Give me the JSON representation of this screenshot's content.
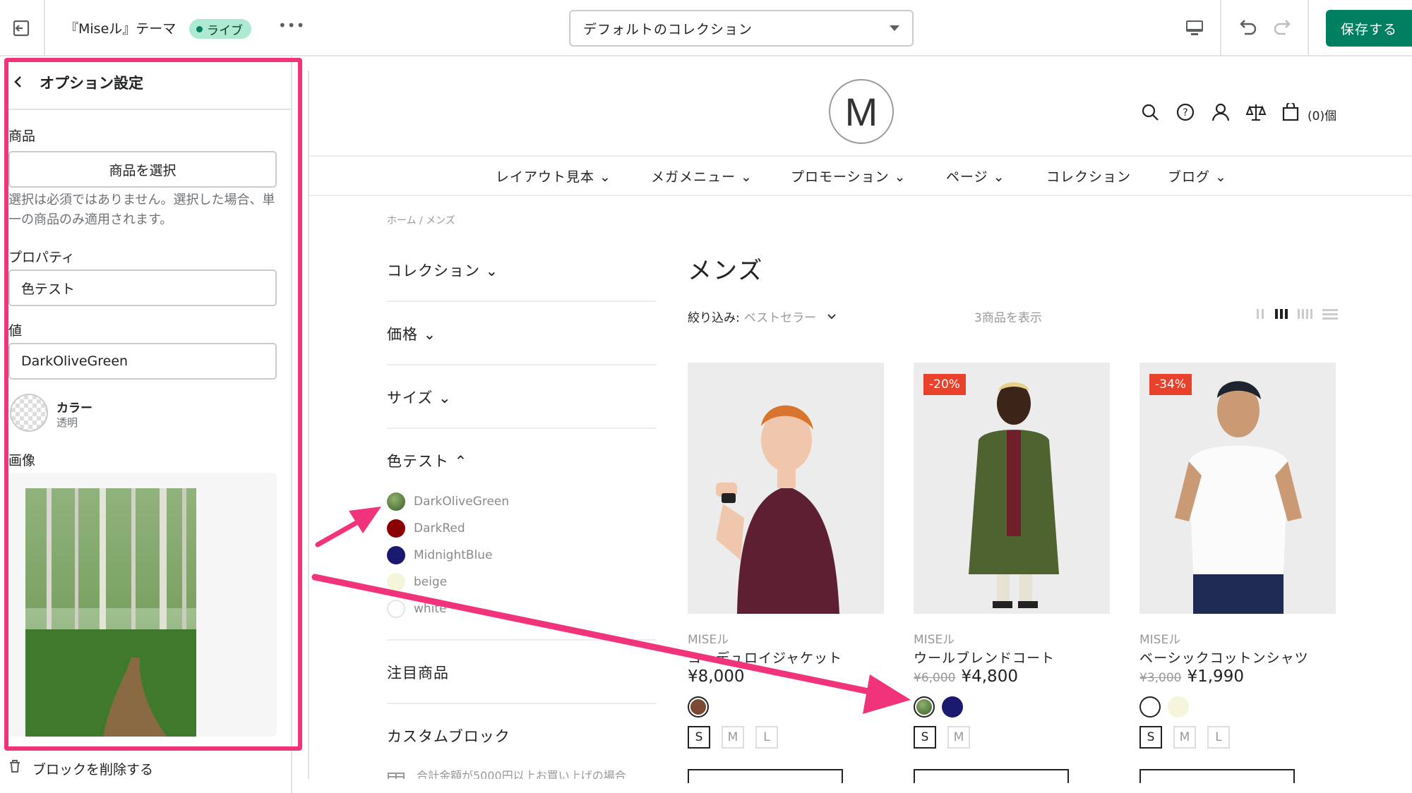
{
  "topbar": {
    "theme_title": "『Miseル』テーマ",
    "live_badge": "ライブ",
    "more_label": "•••",
    "collection_select": "デフォルトのコレクション",
    "save_label": "保存する"
  },
  "left_panel": {
    "title": "オプション設定",
    "product_label": "商品",
    "product_button": "商品を選択",
    "product_help": "選択は必須ではありません。選択した場合、単一の商品のみ適用されます。",
    "property_label": "プロパティ",
    "property_value": "色テスト",
    "value_label": "値",
    "value_value": "DarkOliveGreen",
    "color_label": "カラー",
    "color_sub": "透明",
    "image_label": "画像",
    "delete_label": "ブロックを削除する"
  },
  "store": {
    "logo_letter": "M",
    "cart_count": "(0)個",
    "nav": [
      "レイアウト見本 ⌄",
      "メガメニュー ⌄",
      "プロモーション ⌄",
      "ページ ⌄",
      "コレクション",
      "ブログ ⌄"
    ],
    "breadcrumb": "ホーム / メンズ",
    "page_title": "メンズ",
    "sort_label": "絞り込み:",
    "sort_value": "ベストセラー",
    "count_text": "3商品を表示",
    "filters": {
      "collection": "コレクション ⌄",
      "price": "価格 ⌄",
      "size": "サイズ ⌄",
      "color_test": "色テスト ⌃",
      "featured": "注目商品",
      "custom_block": "カスタムブロック",
      "custom_text": "合計金額が5000円以上お買い上げの場合"
    },
    "colors": [
      {
        "name": "DarkOliveGreen",
        "hex": "#556b2f"
      },
      {
        "name": "DarkRed",
        "hex": "#8b0000"
      },
      {
        "name": "MidnightBlue",
        "hex": "#191970"
      },
      {
        "name": "beige",
        "hex": "#f5f5dc"
      },
      {
        "name": "white",
        "hex": "#ffffff"
      }
    ],
    "products": [
      {
        "vendor": "MISEル",
        "title": "コーデュロイジャケット",
        "old_price": "",
        "price": "¥8,000",
        "discount": "",
        "sizes": [
          "S",
          "M",
          "L"
        ],
        "swatches": [
          "#7a4a34"
        ]
      },
      {
        "vendor": "MISEル",
        "title": "ウールブレンドコート",
        "old_price": "¥6,000",
        "price": "¥4,800",
        "discount": "-20%",
        "sizes": [
          "S",
          "M"
        ],
        "swatches": [
          "#556b2f",
          "#191970"
        ]
      },
      {
        "vendor": "MISEル",
        "title": "ベーシックコットンシャツ",
        "old_price": "¥3,000",
        "price": "¥1,990",
        "discount": "-34%",
        "sizes": [
          "S",
          "M",
          "L"
        ],
        "swatches": [
          "#ffffff",
          "#f5f5dc"
        ]
      }
    ]
  },
  "accent": {
    "highlight": "#f0337a",
    "save": "#008060",
    "discount": "#e8412c"
  }
}
